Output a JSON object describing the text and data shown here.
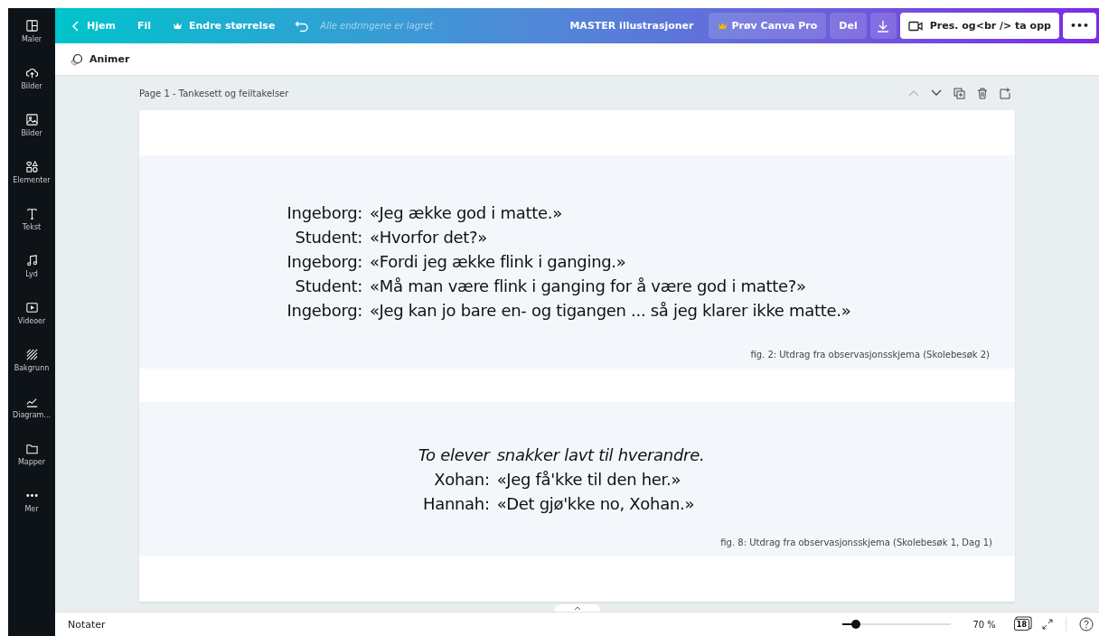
{
  "topbar": {
    "back": "Hjem",
    "file": "Fil",
    "resize": "Endre størrelse",
    "saved": "Alle endringene er lagret",
    "title": "MASTER illustrasjoner",
    "pro": "Prøv Canva Pro",
    "share": "Del",
    "present": "Pres. og<br /> ta opp",
    "more": "•••"
  },
  "sidebar": {
    "items": [
      {
        "label": "Maler"
      },
      {
        "label": "Bilder"
      },
      {
        "label": "Bilder"
      },
      {
        "label": "Elementer"
      },
      {
        "label": "Tekst"
      },
      {
        "label": "Lyd"
      },
      {
        "label": "Videoer"
      },
      {
        "label": "Bakgrunn"
      },
      {
        "label": "Diagram..."
      },
      {
        "label": "Mapper"
      },
      {
        "label": "Mer"
      }
    ]
  },
  "toolbar": {
    "animate": "Animer"
  },
  "page": {
    "title": "Page 1 - Tankesett og feiltakelser",
    "figures": [
      {
        "rows": [
          {
            "speaker": "Ingeborg:",
            "text": "«Jeg ække god i matte.»",
            "italic": false
          },
          {
            "speaker": "Student:",
            "text": "«Hvorfor det?»",
            "italic": false
          },
          {
            "speaker": "Ingeborg:",
            "text": "«Fordi jeg ække flink i ganging.»",
            "italic": false
          },
          {
            "speaker": "Student:",
            "text": "«Må man være flink i ganging for å være god i matte?»",
            "italic": false
          },
          {
            "speaker": "Ingeborg:",
            "text": "«Jeg kan jo bare en- og tigangen ... så jeg klarer ikke matte.»",
            "italic": false
          }
        ],
        "caption": "fig. 2: Utdrag fra observasjonsskjema (Skolebesøk 2)"
      },
      {
        "rows": [
          {
            "speaker": "To elever",
            "text": "snakker lavt til hverandre.",
            "italic": true
          },
          {
            "speaker": "Xohan:",
            "text": "«Jeg få'kke til den her.»",
            "italic": false
          },
          {
            "speaker": "Hannah:",
            "text": "«Det gjø'kke no, Xohan.»",
            "italic": false
          }
        ],
        "caption": "fig. 8: Utdrag fra observasjonsskjema (Skolebesøk 1, Dag 1)"
      }
    ]
  },
  "bottombar": {
    "notes": "Notater",
    "zoom": {
      "level": 0.12
    },
    "zoom_label": "70 %",
    "pages": "18"
  }
}
